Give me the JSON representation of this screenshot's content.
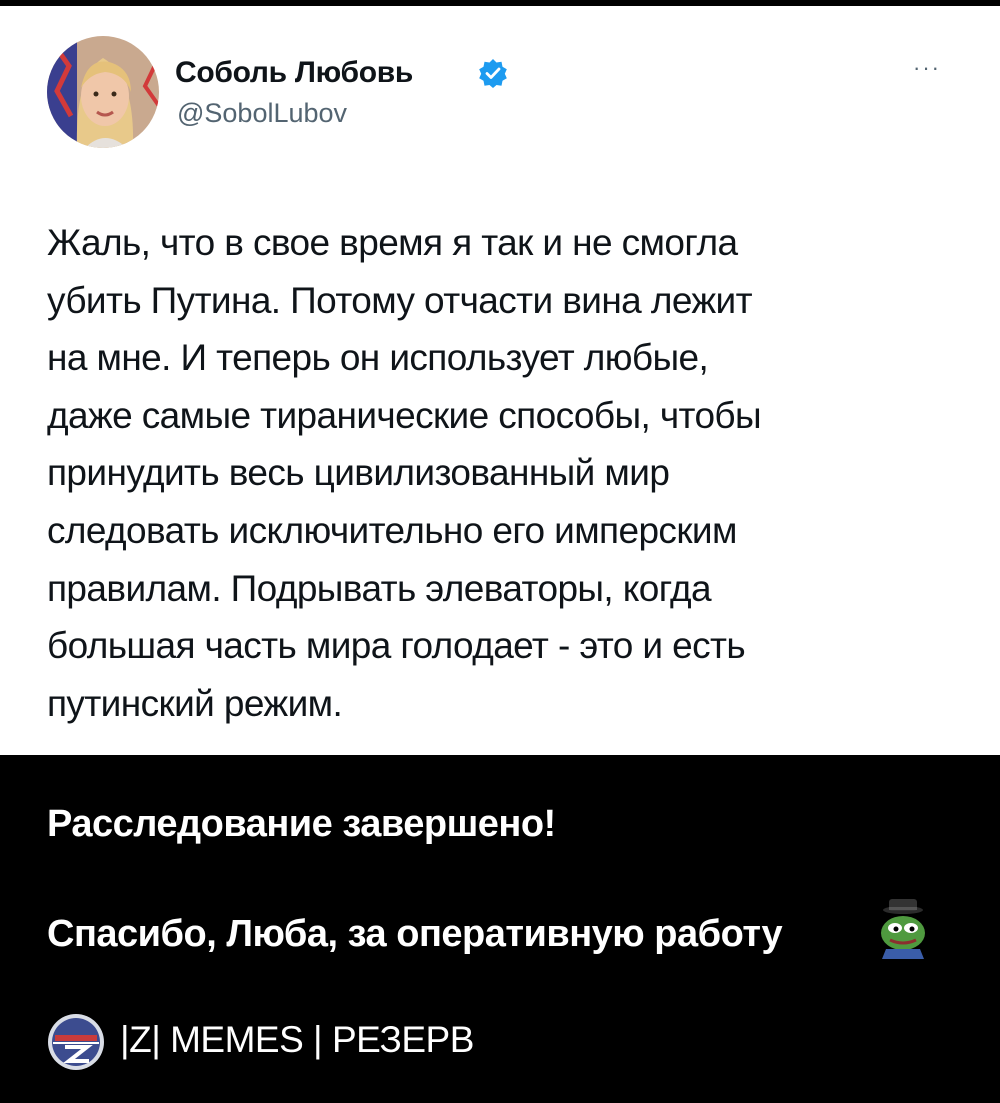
{
  "tweet": {
    "author_name": "Соболь Любовь",
    "author_handle": "@SobolLubov",
    "more_menu": "···",
    "text_lines": [
      "Жаль, что в свое время я так и не смогла",
      "убить Путина. Потому отчасти вина лежит",
      "на мне. И теперь он использует любые,",
      "даже самые тиранические способы, чтобы",
      "принудить весь цивилизованный мир",
      "следовать исключительно его имперским",
      "правилам. Подрывать элеваторы, когда",
      "большая часть мира голодает - это и есть",
      "путинский режим."
    ]
  },
  "caption": {
    "line1": "Расследование завершено!",
    "line2": "Спасибо, Люба, за оперативную работу",
    "channel_name": "|Z| MEMES | РЕЗЕРВ"
  },
  "icons": {
    "verified": "verified-badge-icon",
    "pepe": "pepe-detective-icon",
    "channel_logo": "z-memes-logo-icon"
  },
  "colors": {
    "verified_blue": "#1d9bf0",
    "handle_gray": "#536471",
    "tweet_background": "#ffffff",
    "caption_background": "#000000"
  }
}
